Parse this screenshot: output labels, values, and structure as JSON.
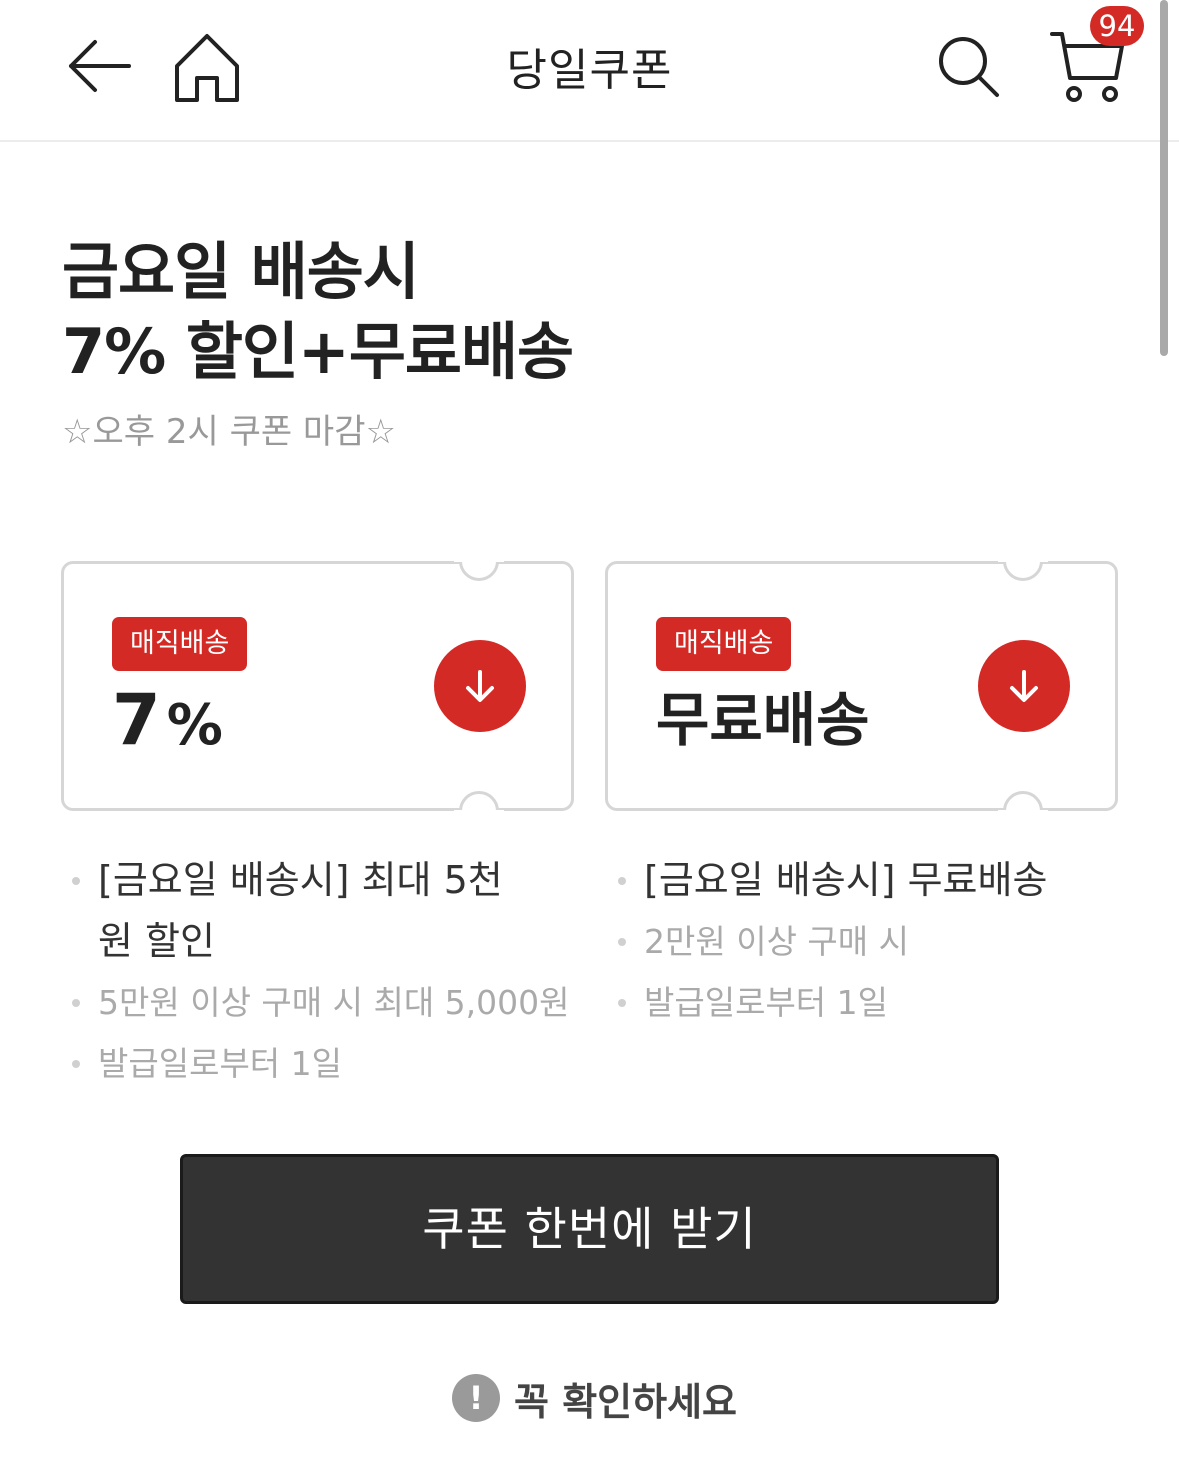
{
  "header": {
    "title": "당일쿠폰",
    "cart_count": "94",
    "icons": [
      "back-arrow-icon",
      "home-icon",
      "search-icon",
      "cart-icon"
    ]
  },
  "promo": {
    "headline_line1": "금요일 배송시",
    "headline_line2": "7% 할인+무료배송",
    "subline": "☆오후 2시 쿠폰 마감☆"
  },
  "coupons": [
    {
      "tag": "매직배송",
      "value_num": "7",
      "value_unit": "%",
      "details": {
        "main_line1": "[금요일 배송시] 최대 5천",
        "main_line2": "원 할인",
        "condition": "5만원 이상 구매 시 최대 5,000원",
        "validity": "발급일로부터 1일"
      }
    },
    {
      "tag": "매직배송",
      "value_text": "무료배송",
      "details": {
        "main": "[금요일 배송시] 무료배송",
        "condition": "2만원 이상 구매 시",
        "validity": "발급일로부터 1일"
      }
    }
  ],
  "cta": {
    "label": "쿠폰 한번에 받기"
  },
  "notice": {
    "icon": "!",
    "label": "꼭 확인하세요"
  },
  "colors": {
    "accent": "#d42a26",
    "button_dark": "#333333",
    "border": "#d6d6d6",
    "muted_text": "#aaaaaa"
  }
}
